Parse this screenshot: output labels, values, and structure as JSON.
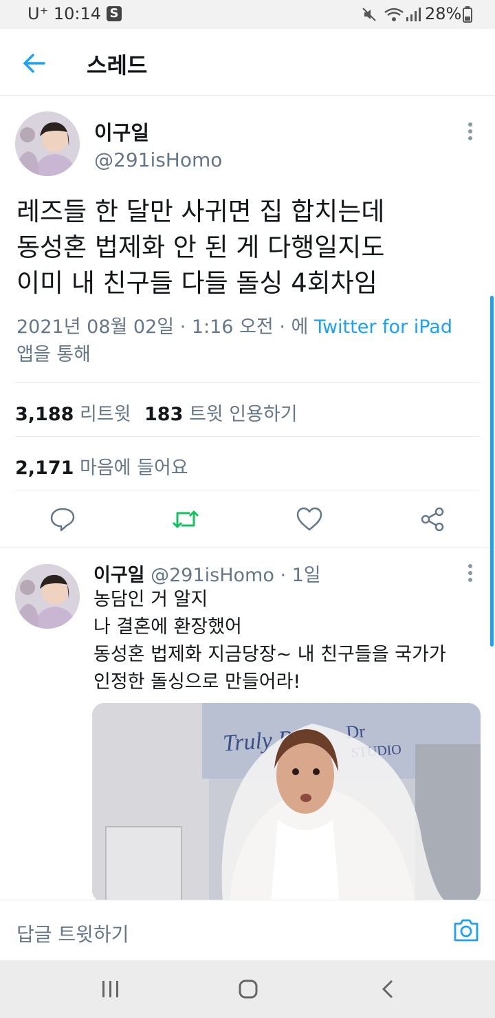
{
  "status_bar": {
    "carrier_time": "U⁺ 10:14",
    "battery": "28%"
  },
  "header": {
    "title": "스레드"
  },
  "tweet": {
    "author_name": "이구일",
    "author_handle": "@291isHomo",
    "text_lines": [
      "레즈들 한 달만 사귀면 집 합치는데",
      "동성혼 법제화 안 된 게 다행일지도",
      "이미 내 친구들 다들 돌싱 4회차임"
    ],
    "timestamp": "2021년 08월 02일 · 1:16 오전 · 에 ",
    "source_link": "Twitter for iPad",
    "source_suffix": "앱을 통해",
    "retweets": "3,188",
    "retweets_label": "리트윗",
    "quotes": "183",
    "quotes_label": "트윗 인용하기",
    "likes": "2,171",
    "likes_label": "마음에 들어요"
  },
  "reply": {
    "author_name": "이구일",
    "author_handle_time": "@291isHomo · 1일",
    "text_lines": [
      "농담인 거 알지",
      "나 결혼에 환장했어",
      "동성혼 법제화 지금당장~ 내 친구들을 국가가",
      "인정한 돌싱으로 만들어라!"
    ],
    "image_sign_text": "Truly Bride Dress STUDIO"
  },
  "compose": {
    "placeholder": "답글 트윗하기"
  },
  "icons": {
    "back": "arrow-left-icon",
    "more": "more-vertical-icon",
    "reply": "comment-icon",
    "retweet": "retweet-icon",
    "like": "heart-icon",
    "share": "share-icon",
    "camera": "camera-icon",
    "nav_recents": "recents-icon",
    "nav_home": "home-icon",
    "nav_back": "back-icon"
  },
  "colors": {
    "accent": "#1da1f2",
    "retweet_green": "#17bf63",
    "secondary_text": "#657786"
  }
}
